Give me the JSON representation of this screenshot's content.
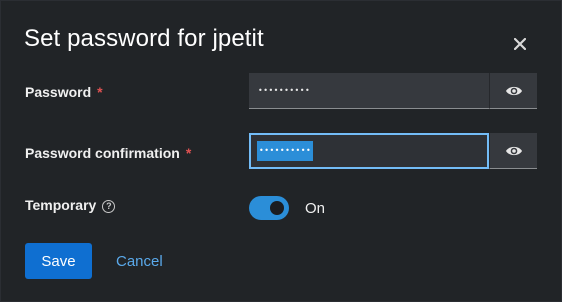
{
  "modal": {
    "title": "Set password for jpetit",
    "close_icon": "close-icon"
  },
  "form": {
    "password": {
      "label": "Password",
      "required_marker": "*",
      "value_masked": "••••••••••",
      "toggle_icon": "eye-icon"
    },
    "password_confirmation": {
      "label": "Password confirmation",
      "required_marker": "*",
      "value_masked": "••••••••••",
      "selected": true,
      "toggle_icon": "eye-icon"
    },
    "temporary": {
      "label": "Temporary",
      "help_icon": "question-circle-icon",
      "help_glyph": "?",
      "toggle_on": true,
      "toggle_label": "On"
    }
  },
  "actions": {
    "save_label": "Save",
    "cancel_label": "Cancel"
  },
  "colors": {
    "accent": "#2b8ed8",
    "primary_button": "#0f6fd1",
    "link": "#5aa9ea",
    "required": "#e05252",
    "background": "#212427"
  }
}
